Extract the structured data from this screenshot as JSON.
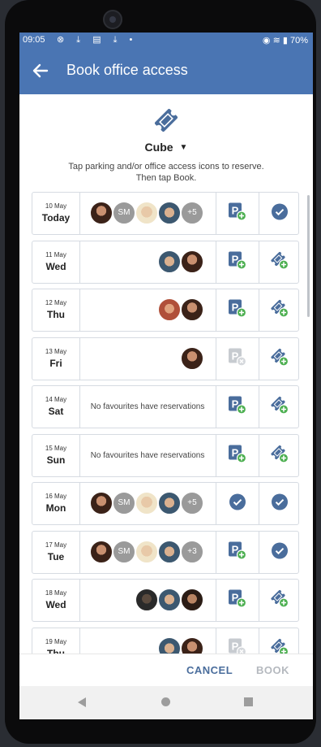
{
  "status_bar": {
    "time": "09:05",
    "battery": "70%",
    "left_icons": "⊗ ⤓ ▤ ⤓ •",
    "right_icons": "◉ ≋ ▮"
  },
  "app_bar": {
    "title": "Book office access",
    "back_icon": "arrow-left-icon"
  },
  "header": {
    "location": "Cube",
    "hint_line1": "Tap parking and/or office access icons to reserve.",
    "hint_line2": "Then tap Book."
  },
  "colors": {
    "primary": "#4a75b3",
    "icon_blue": "#4a6d9c",
    "green": "#4caf50",
    "disabled": "#c7cbd0"
  },
  "days": [
    {
      "date": "10 May",
      "weekday": "Today",
      "favourites": [
        "photo-f1",
        "SM",
        "photo-m1",
        "photo-m2",
        "+5"
      ],
      "parking": "add",
      "office": "booked"
    },
    {
      "date": "11 May",
      "weekday": "Wed",
      "favourites": [
        "photo-m2",
        "photo-f1"
      ],
      "parking": "add",
      "office": "add"
    },
    {
      "date": "12 May",
      "weekday": "Thu",
      "favourites": [
        "photo-m3",
        "photo-f1"
      ],
      "parking": "add",
      "office": "add"
    },
    {
      "date": "13 May",
      "weekday": "Fri",
      "favourites": [
        "photo-f1"
      ],
      "parking": "unavailable",
      "office": "add"
    },
    {
      "date": "14 May",
      "weekday": "Sat",
      "text": "No favourites have reservations",
      "parking": "add",
      "office": "add"
    },
    {
      "date": "15 May",
      "weekday": "Sun",
      "text": "No favourites have reservations",
      "parking": "add",
      "office": "add"
    },
    {
      "date": "16 May",
      "weekday": "Mon",
      "favourites": [
        "photo-f1",
        "SM",
        "photo-m1",
        "photo-m2",
        "+5"
      ],
      "parking": "booked",
      "office": "booked"
    },
    {
      "date": "17 May",
      "weekday": "Tue",
      "favourites": [
        "photo-f1",
        "SM",
        "photo-m1",
        "photo-m2",
        "+3"
      ],
      "parking": "add",
      "office": "booked"
    },
    {
      "date": "18 May",
      "weekday": "Wed",
      "favourites": [
        "photo-m4",
        "photo-m2",
        "photo-m5"
      ],
      "parking": "add",
      "office": "add"
    },
    {
      "date": "19 May",
      "weekday": "Thu",
      "favourites": [
        "photo-m2",
        "photo-f1"
      ],
      "parking": "unavailable",
      "office": "add"
    }
  ],
  "footer": {
    "cancel": "CANCEL",
    "book": "BOOK"
  }
}
